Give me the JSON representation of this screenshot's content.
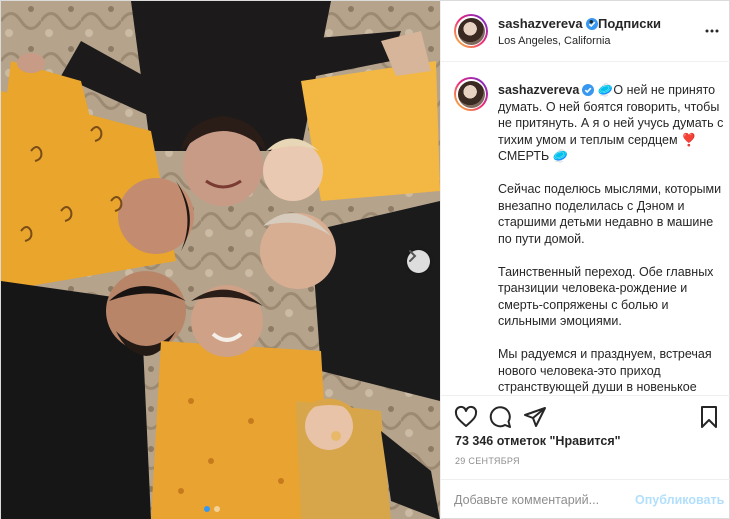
{
  "post": {
    "header": {
      "username": "sashazvereva",
      "separator": "•",
      "follow_label": "Подписки",
      "location": "Los Angeles, California"
    },
    "caption": {
      "username": "sashazvereva",
      "paragraphs": [
        "О ней не принято думать. О ней боятся говорить, чтобы не притянуть. А я о ней учусь думать с тихим умом и теплым сердцем",
        "Сейчас поделюсь мыслями, которыми внезапно поделилась с Дэном и старшими детьми недавно в машине по пути домой.",
        "Таинственный переход. Обе главных транзиции человека-рождение и смерть-сопряжены с болью и сильными эмоциями.",
        "Мы радуемся и празднуем, встречая нового человека-это приход странствующей души в новенькое тело, мы приветствуем нового"
      ],
      "inline_word": "СМЕРТЬ",
      "emojis": [
        "🥏",
        "❣️",
        "🥏"
      ]
    },
    "likes": "73 346 отметок \"Нравится\"",
    "date": "29 СЕНТЯБРЯ",
    "comment": {
      "placeholder": "Добавьте комментарий...",
      "value": "",
      "publish_label": "Опубликовать"
    },
    "carousel": {
      "slide_count": 2,
      "active_slide": 1
    },
    "icons": [
      "heart-icon",
      "comment-icon",
      "share-icon",
      "bookmark-icon",
      "more-icon",
      "verified-icon",
      "chevron-right-icon"
    ],
    "colors": {
      "verified": "#3897f0",
      "publish_disabled": "#b2dffc",
      "border": "#efefef",
      "muted": "#8e8e8e"
    }
  }
}
